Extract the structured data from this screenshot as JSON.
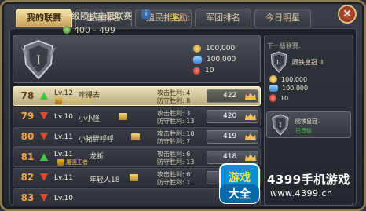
{
  "tabs": [
    {
      "label": "我的联赛"
    },
    {
      "label": "皇冠排名"
    },
    {
      "label": "殖民排名"
    },
    {
      "label": "军团排名"
    },
    {
      "label": "今日明星"
    }
  ],
  "close_label": "✕",
  "rank_card": {
    "title": "一级陨铁皇冠联赛",
    "info_icon": "i",
    "range": "400 - 499",
    "shield_numeral": "I",
    "reward_label": "奖励:",
    "rewards": [
      {
        "icon": "coin-icon",
        "value": "100,000"
      },
      {
        "icon": "stone-icon",
        "value": "100,000"
      },
      {
        "icon": "gem-icon",
        "value": "10"
      }
    ]
  },
  "rows": [
    {
      "rank": "78",
      "trend": "up",
      "level": "Lv.12",
      "name": "咋得去",
      "guild": "荡羽102团",
      "attack": "攻击胜利: 4",
      "defend": "防守胜利: 8",
      "score": "422",
      "selected": true
    },
    {
      "rank": "79",
      "trend": "down",
      "level": "Lv.10",
      "name": "小小怪",
      "guild": "",
      "attack": "攻击胜利: 3",
      "defend": "防守胜利: 13",
      "score": "420",
      "selected": false
    },
    {
      "rank": "80",
      "trend": "down",
      "level": "Lv.11",
      "name": "小猪胖呼呼",
      "guild": "",
      "attack": "攻击胜利: 10",
      "defend": "防守胜利: 7",
      "score": "419",
      "selected": false
    },
    {
      "rank": "81",
      "trend": "up",
      "level": "Lv.11",
      "name": "龙祈",
      "guild": "屠强王者",
      "attack": "攻击胜利: 6",
      "defend": "防守胜利: 13",
      "score": "418",
      "selected": false
    },
    {
      "rank": "82",
      "trend": "down",
      "level": "Lv.11",
      "name": "年轻人18",
      "guild": "",
      "attack": "攻击胜利: 6",
      "defend": "防守胜利: 1",
      "score": "418",
      "selected": false
    },
    {
      "rank": "83",
      "trend": "down",
      "level": "Lv.10",
      "name": "",
      "guild": "",
      "attack": "",
      "defend": "",
      "score": "",
      "selected": false
    }
  ],
  "side": {
    "next_label": "下一级联赛:",
    "next_name": "陨铁皇冠 II",
    "next_numeral": "II",
    "rewards": [
      {
        "icon": "coin-icon",
        "value": "100,000"
      },
      {
        "icon": "stone-icon",
        "value": "100,000"
      },
      {
        "icon": "gem-icon",
        "value": "10"
      }
    ],
    "current_name": "陨铁皇冠 I",
    "current_status": "已晋级"
  },
  "watermark": {
    "logo_top": "游戏",
    "logo_bottom": "大全",
    "line1": "4399手机游戏",
    "line2": "www.4399.cn"
  },
  "colors": {
    "gold": "#f2c14e",
    "rank_orange": "#f0a14a",
    "up_green": "#45c443",
    "down_red": "#e04a2a",
    "selected_row": "#e9dfb9"
  }
}
